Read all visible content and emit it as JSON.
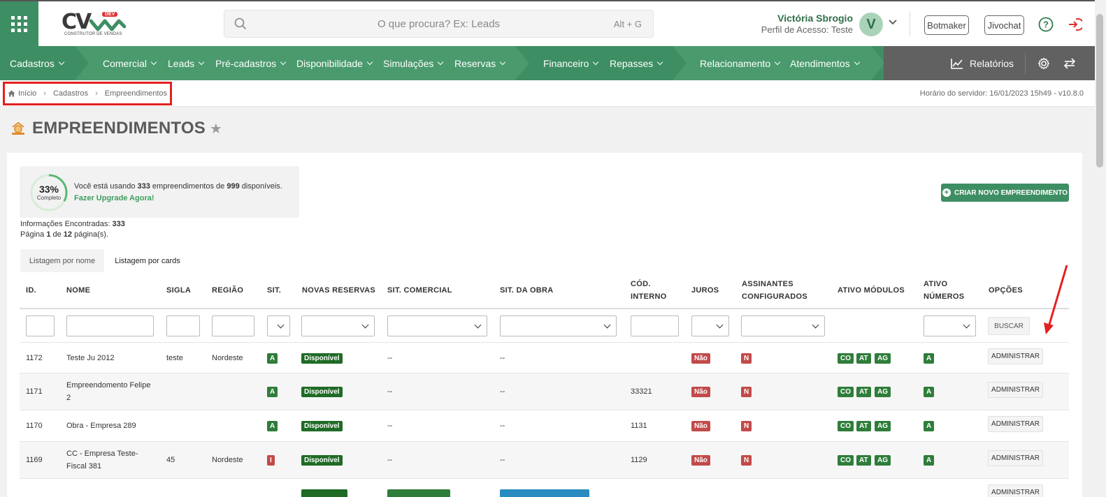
{
  "header": {
    "logo_text": "CV",
    "logo_badge": "DEV",
    "logo_sub": "CONSTRUTOR DE VENDAS",
    "search_placeholder": "O que procura? Ex: Leads",
    "search_shortcut": "Alt + G",
    "user_name": "Victória Sbrogio",
    "user_profile": "Perfil de Acesso: Teste",
    "avatar_letter": "V",
    "botmaker": "Botmaker",
    "jivochat": "Jivochat"
  },
  "nav": {
    "items": [
      "Cadastros",
      "Comercial",
      "Leads",
      "Pré-cadastros",
      "Disponibilidade",
      "Simulações",
      "Reservas",
      "Financeiro",
      "Repasses",
      "Relacionamento",
      "Atendimentos"
    ],
    "reports": "Relatórios",
    "colors": {
      "green": "#3e8e63",
      "gray": "#616161"
    }
  },
  "breadcrumb": {
    "items": [
      "Início",
      "Cadastros",
      "Empreendimentos"
    ],
    "server_time": "Horário do servidor: 16/01/2023 15h49 - v10.8.0"
  },
  "page": {
    "title": "EMPREENDIMENTOS"
  },
  "usage": {
    "percent": "33%",
    "percent_value": 0.33,
    "label": "Completo",
    "text_pre": "Você está usando ",
    "used": "333",
    "text_mid": " empreendimentos de ",
    "total": "999",
    "text_post": " disponíveis.",
    "upgrade": "Fazer Upgrade Agora!"
  },
  "results": {
    "found_label": "Informações Encontradas: ",
    "found_value": "333",
    "page_pre": "Página ",
    "page_cur": "1",
    "page_mid": " de ",
    "page_total": "12",
    "page_post": " página(s)."
  },
  "create_button": "CRIAR NOVO EMPREENDIMENTO",
  "tabs": [
    "Listagem por nome",
    "Listagem por cards"
  ],
  "table": {
    "headers": {
      "id": "ID.",
      "nome": "NOME",
      "sigla": "SIGLA",
      "regiao": "REGIÃO",
      "sit": "SIT.",
      "novas_reservas": "NOVAS RESERVAS",
      "sit_comercial": "SIT. COMERCIAL",
      "sit_obra": "SIT. DA OBRA",
      "cod_interno_1": "CÓD.",
      "cod_interno_2": "INTERNO",
      "juros": "JUROS",
      "assinantes_1": "ASSINANTES",
      "assinantes_2": "CONFIGURADOS",
      "ativo_modulos": "ATIVO MÓDULOS",
      "ativo_numeros_1": "ATIVO",
      "ativo_numeros_2": "NÚMEROS",
      "opcoes": "OPÇÕES"
    },
    "buscar": "BUSCAR",
    "rows": [
      {
        "id": "1172",
        "nome1": "Teste Ju 2012",
        "nome2": "",
        "sigla": "teste",
        "regiao": "Nordeste",
        "sit": "A",
        "reserva": "Disponível",
        "comercial": "--",
        "obra": "--",
        "cod": "",
        "juros": "Não",
        "assin": "N",
        "mods": [
          "CO",
          "AT",
          "AG"
        ],
        "num": "A",
        "opt": "ADMINISTRAR"
      },
      {
        "id": "1171",
        "nome1": "Empreendomento Felipe",
        "nome2": "2",
        "sigla": "",
        "regiao": "",
        "sit": "A",
        "reserva": "Disponível",
        "comercial": "--",
        "obra": "--",
        "cod": "33321",
        "juros": "Não",
        "assin": "N",
        "mods": [
          "CO",
          "AT",
          "AG"
        ],
        "num": "A",
        "opt": "ADMINISTRAR"
      },
      {
        "id": "1170",
        "nome1": "Obra - Empresa 289",
        "nome2": "",
        "sigla": "",
        "regiao": "",
        "sit": "A",
        "reserva": "Disponível",
        "comercial": "--",
        "obra": "--",
        "cod": "1131",
        "juros": "Não",
        "assin": "N",
        "mods": [
          "CO",
          "AT",
          "AG"
        ],
        "num": "A",
        "opt": "ADMINISTRAR"
      },
      {
        "id": "1169",
        "nome1": "CC - Empresa Teste-",
        "nome2": "Fiscal 381",
        "sigla": "45",
        "regiao": "Nordeste",
        "sit": "I",
        "reserva": "Disponível",
        "comercial": "--",
        "obra": "--",
        "cod": "1129",
        "juros": "Não",
        "assin": "N",
        "mods": [
          "CO",
          "AT",
          "AG"
        ],
        "num": "A",
        "opt": "ADMINISTRAR"
      }
    ]
  }
}
